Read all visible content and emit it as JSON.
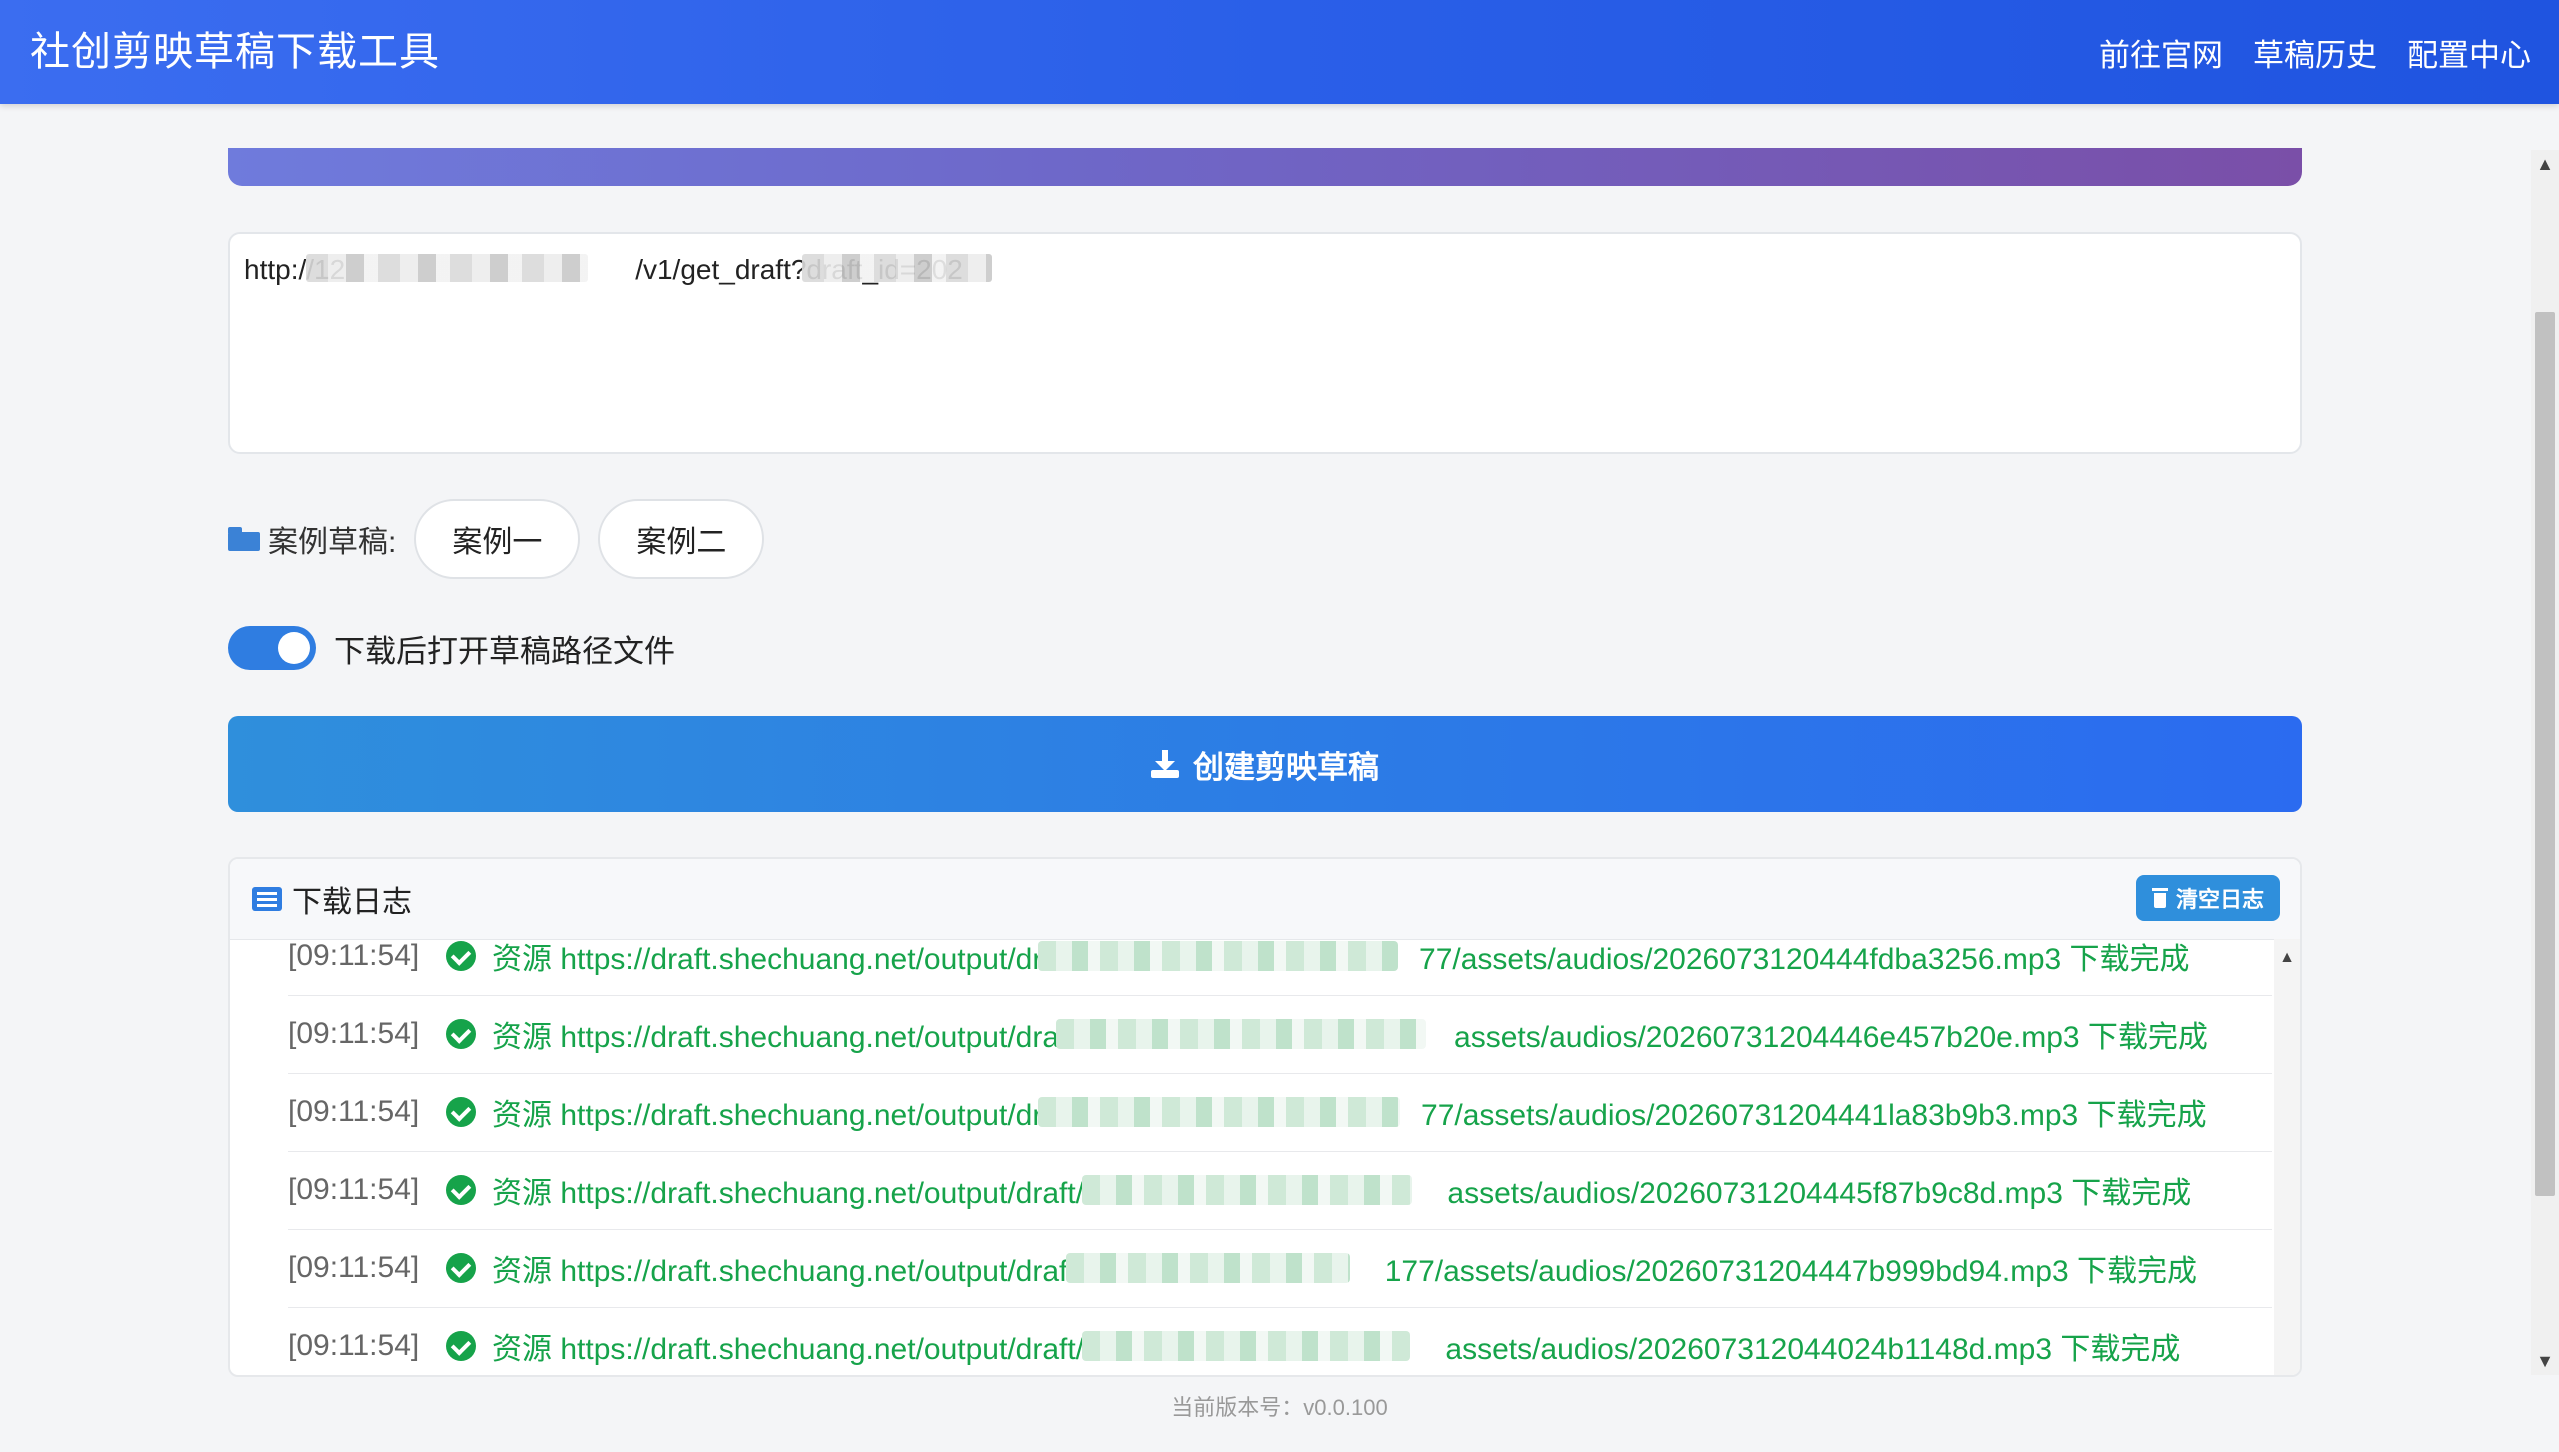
{
  "app": {
    "title": "社创剪映草稿下载工具"
  },
  "nav": {
    "links": [
      "前往官网",
      "草稿历史",
      "配置中心"
    ]
  },
  "url_input": {
    "value_visible_start": "http://12",
    "value_visible_mid": "/v1/get_draft?draft_id=202"
  },
  "samples": {
    "label": "案例草稿:",
    "items": [
      "案例一",
      "案例二"
    ],
    "icon": "folder-open-icon"
  },
  "toggle": {
    "label": "下载后打开草稿路径文件",
    "on": true
  },
  "create_button": {
    "label": "创建剪映草稿",
    "icon": "download-icon"
  },
  "log": {
    "title": "下载日志",
    "clear_label": "清空日志",
    "rows": [
      {
        "time": "[09:11:54]",
        "prefix": "资源 https://draft.shechuang.net/output/dra",
        "suffix": "77/assets/audios/2026073120444fdba3256.mp3 下载完成"
      },
      {
        "time": "[09:11:54]",
        "prefix": "资源 https://draft.shechuang.net/output/draft/",
        "suffix": "assets/audios/20260731204446e457b20e.mp3 下载完成"
      },
      {
        "time": "[09:11:54]",
        "prefix": "资源 https://draft.shechuang.net/output/dra",
        "suffix": "77/assets/audios/20260731204441la83b9b3.mp3 下载完成"
      },
      {
        "time": "[09:11:54]",
        "prefix": "资源 https://draft.shechuang.net/output/draft/20",
        "suffix": "assets/audios/20260731204445f87b9c8d.mp3 下载完成"
      },
      {
        "time": "[09:11:54]",
        "prefix": "资源 https://draft.shechuang.net/output/draft/2",
        "suffix": "177/assets/audios/20260731204447b999bd94.mp3 下载完成"
      },
      {
        "time": "[09:11:54]",
        "prefix": "资源 https://draft.shechuang.net/output/draft/20",
        "suffix": "assets/audios/202607312044024b1148d.mp3 下载完成"
      }
    ]
  },
  "footer": {
    "version_label": "当前版本号：",
    "version": "v0.0.100"
  },
  "colors": {
    "nav": "#2a5fe8",
    "accent": "#2f7de1",
    "success": "#16a34a"
  }
}
